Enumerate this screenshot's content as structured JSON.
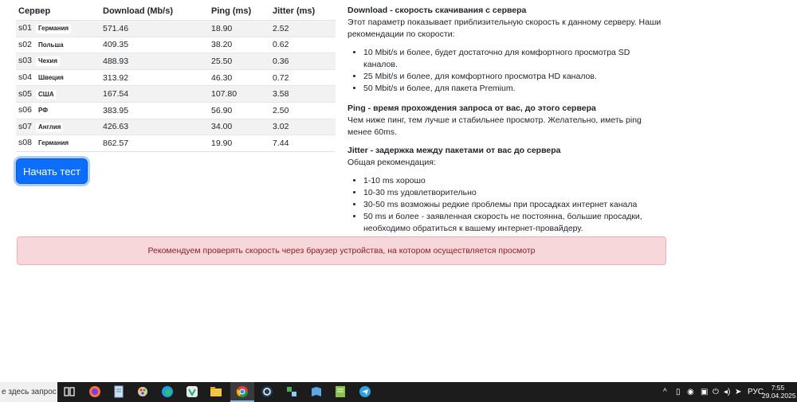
{
  "table": {
    "headers": {
      "server": "Сервер",
      "download": "Download (Mb/s)",
      "ping": "Ping (ms)",
      "jitter": "Jitter (ms)"
    },
    "rows": [
      {
        "id": "s01",
        "country": "Германия",
        "download": "571.46",
        "ping": "18.90",
        "jitter": "2.52"
      },
      {
        "id": "s02",
        "country": "Польша",
        "download": "409.35",
        "ping": "38.20",
        "jitter": "0.62"
      },
      {
        "id": "s03",
        "country": "Чехия",
        "download": "488.93",
        "ping": "25.50",
        "jitter": "0.36"
      },
      {
        "id": "s04",
        "country": "Швеция",
        "download": "313.92",
        "ping": "46.30",
        "jitter": "0.72"
      },
      {
        "id": "s05",
        "country": "США",
        "download": "167.54",
        "ping": "107.80",
        "jitter": "3.58"
      },
      {
        "id": "s06",
        "country": "РФ",
        "download": "383.95",
        "ping": "56.90",
        "jitter": "2.50"
      },
      {
        "id": "s07",
        "country": "Англия",
        "download": "426.63",
        "ping": "34.00",
        "jitter": "3.02"
      },
      {
        "id": "s08",
        "country": "Германия",
        "download": "862.57",
        "ping": "19.90",
        "jitter": "7.44"
      }
    ]
  },
  "start_button": "Начать тест",
  "info": {
    "download": {
      "title": "Download - скорость скачивания с сервера",
      "text": "Этот параметр показывает приблизительную скорость к данному серверу. Наши рекомендации по скорости:",
      "items": [
        "10 Mbit/s и более, будет достаточно для комфортного просмотра SD каналов.",
        "25 Mbit/s и более, для комфортного просмотра HD каналов.",
        "50 Mbit/s и более, для пакета Premium."
      ]
    },
    "ping": {
      "title": "Ping - время прохождения запроса от вас, до этого сервера",
      "text": "Чем ниже пинг, тем лучше и стабильнее просмотр. Желательно, иметь ping менее 60ms."
    },
    "jitter": {
      "title": "Jitter - задержка между пакетами от вас до сервера",
      "text": "Общая рекомендация:",
      "items": [
        "1-10 ms хорошо",
        "10-30 ms удовлетворительно",
        "30-50 ms возможны редкие проблемы при просадках интернет канала",
        "50 ms и более - заявленная скорость не постоянна, большие просадки, необходимо обратиться к вашему интернет-провайдеру."
      ]
    }
  },
  "alert": "Рекомендуем проверять скорость через браузер устройства, на котором осуществляется просмотр",
  "taskbar": {
    "search": "е здесь запрос",
    "icons": [
      "task-view-icon",
      "firefox-icon",
      "notepad-icon",
      "paint-icon",
      "edge-icon",
      "vpn-icon",
      "file-explorer-icon",
      "chrome-icon",
      "app-icon",
      "network-app-icon",
      "book-icon",
      "editor-icon",
      "telegram-icon"
    ],
    "lang": "РУС",
    "time": "7:55",
    "date": "29.04.2025"
  }
}
